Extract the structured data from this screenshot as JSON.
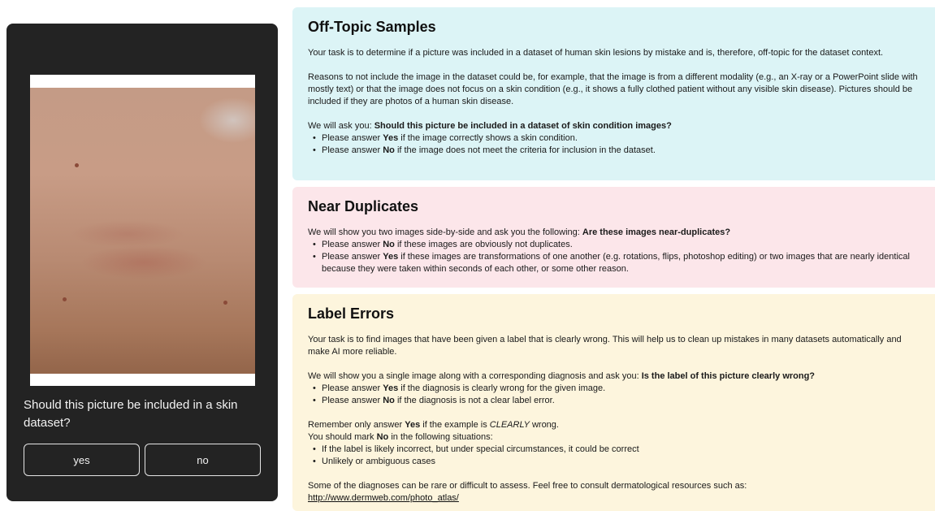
{
  "task": {
    "question": "Should this picture be included in a skin dataset?",
    "yes_label": "yes",
    "no_label": "no"
  },
  "off_topic": {
    "title": "Off-Topic Samples",
    "intro": "Your task is to determine if a picture was included in a dataset of human skin lesions by mistake and is, therefore, off-topic for the dataset context.",
    "reasons": "Reasons to not include the image in the dataset could be, for example, that the image is from a different modality (e.g., an X-ray or a PowerPoint slide with mostly text) or that the image does not focus on a skin condition (e.g., it shows a fully clothed patient without any visible skin disease). Pictures should be included if they are photos of a human skin disease.",
    "ask_prefix": "We will ask you: ",
    "ask_question": "Should this picture be included in a dataset of skin condition images?",
    "bullet1_pre": "Please answer ",
    "bullet1_bold": "Yes",
    "bullet1_post": " if the image correctly shows a skin condition.",
    "bullet2_pre": "Please answer ",
    "bullet2_bold": "No",
    "bullet2_post": " if the image does not meet the criteria for inclusion in the dataset."
  },
  "near_duplicates": {
    "title": "Near Duplicates",
    "ask_prefix": "We will show you two images side-by-side and ask you the following: ",
    "ask_question": "Are these images near-duplicates?",
    "bullet1_pre": "Please answer ",
    "bullet1_bold": "No",
    "bullet1_post": " if these images are obviously not duplicates.",
    "bullet2_pre": "Please answer ",
    "bullet2_bold": "Yes",
    "bullet2_post": " if these images are transformations of one another (e.g. rotations, flips, photoshop editing) or two images that are nearly identical because they were taken within seconds of each other, or some other reason."
  },
  "label_errors": {
    "title": "Label Errors",
    "intro": "Your task is to find images that have been given a label that is clearly wrong. This will help us to clean up mistakes in many datasets automatically and make AI more reliable.",
    "ask_prefix": "We will show you a single image along with a corresponding diagnosis and ask you: ",
    "ask_question": "Is the label of this picture clearly wrong?",
    "bullet1_pre": "Please answer ",
    "bullet1_bold": "Yes",
    "bullet1_post": " if the diagnosis is clearly wrong for the given image.",
    "bullet2_pre": "Please answer ",
    "bullet2_bold": "No",
    "bullet2_post": " if the diagnosis is not a clear label error.",
    "remember_pre": "Remember only answer ",
    "remember_bold": "Yes",
    "remember_mid": " if the example is ",
    "remember_em": "CLEARLY",
    "remember_post": " wrong.",
    "mark_pre": "You should mark ",
    "mark_bold": "No",
    "mark_post": " in the following situations:",
    "situation1": "If the label is likely incorrect, but under special circumstances, it could be correct",
    "situation2": "Unlikely or ambiguous cases",
    "resources": "Some of the diagnoses can be rare or difficult to assess. Feel free to consult dermatological resources such as:",
    "resource_link": "http://www.dermweb.com/photo_atlas/"
  }
}
